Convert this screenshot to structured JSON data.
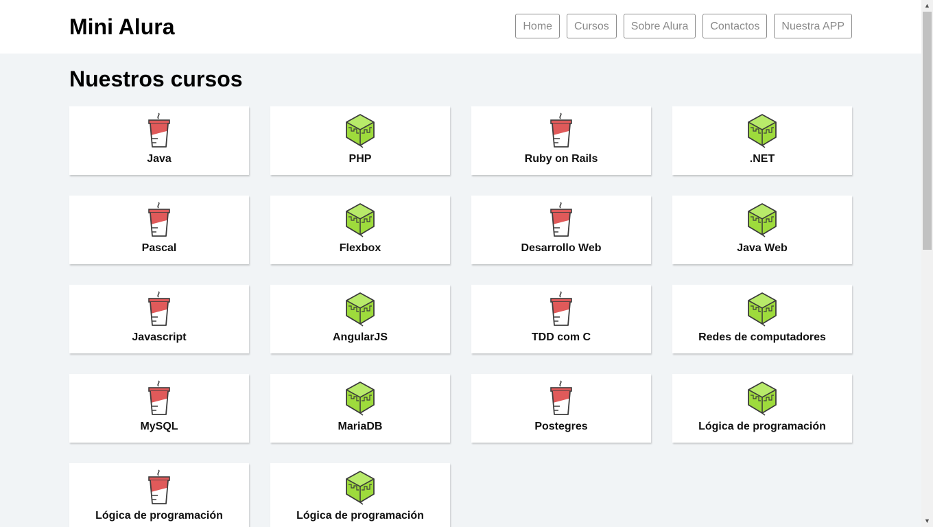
{
  "brand": "Mini Alura",
  "nav": [
    "Home",
    "Cursos",
    "Sobre Alura",
    "Contactos",
    "Nuestra APP"
  ],
  "page_title": "Nuestros cursos",
  "courses": [
    {
      "name": "Java",
      "icon": "coffee-cup-icon"
    },
    {
      "name": "PHP",
      "icon": "green-cube-icon"
    },
    {
      "name": "Ruby on Rails",
      "icon": "coffee-cup-icon"
    },
    {
      "name": ".NET",
      "icon": "green-cube-icon"
    },
    {
      "name": "Pascal",
      "icon": "coffee-cup-icon"
    },
    {
      "name": "Flexbox",
      "icon": "green-cube-icon"
    },
    {
      "name": "Desarrollo Web",
      "icon": "coffee-cup-icon"
    },
    {
      "name": "Java Web",
      "icon": "green-cube-icon"
    },
    {
      "name": "Javascript",
      "icon": "coffee-cup-icon"
    },
    {
      "name": "AngularJS",
      "icon": "green-cube-icon"
    },
    {
      "name": "TDD com C",
      "icon": "coffee-cup-icon"
    },
    {
      "name": "Redes de computadores",
      "icon": "green-cube-icon"
    },
    {
      "name": "MySQL",
      "icon": "coffee-cup-icon"
    },
    {
      "name": "MariaDB",
      "icon": "green-cube-icon"
    },
    {
      "name": "Postegres",
      "icon": "coffee-cup-icon"
    },
    {
      "name": "Lógica de programación",
      "icon": "green-cube-icon"
    },
    {
      "name": "Lógica de programación",
      "icon": "coffee-cup-icon"
    },
    {
      "name": "Lógica de programación",
      "icon": "green-cube-icon"
    }
  ],
  "colors": {
    "page_background": "#f1f4f6",
    "cup_red": "#e05a5a",
    "cube_green": "#9edb3c",
    "icon_stroke": "#3c3c3c"
  }
}
